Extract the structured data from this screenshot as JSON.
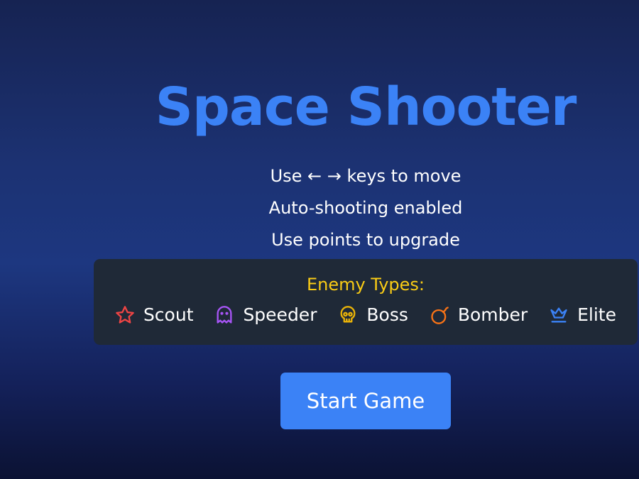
{
  "title": "Space Shooter",
  "instructions": {
    "move": "Use ← → keys to move",
    "shoot": "Auto-shooting enabled",
    "upgrade": "Use points to upgrade"
  },
  "enemy_panel": {
    "title": "Enemy Types:",
    "enemies": [
      {
        "name": "Scout",
        "icon": "star-icon",
        "color": "#ef4444"
      },
      {
        "name": "Speeder",
        "icon": "ghost-icon",
        "color": "#a855f7"
      },
      {
        "name": "Boss",
        "icon": "skull-icon",
        "color": "#eab308"
      },
      {
        "name": "Bomber",
        "icon": "bomb-icon",
        "color": "#f97316"
      },
      {
        "name": "Elite",
        "icon": "crown-icon",
        "color": "#3b82f6"
      }
    ]
  },
  "start_button": "Start Game",
  "colors": {
    "accent": "#3b82f6",
    "panel": "#1f2937",
    "panel_title": "#facc15"
  }
}
